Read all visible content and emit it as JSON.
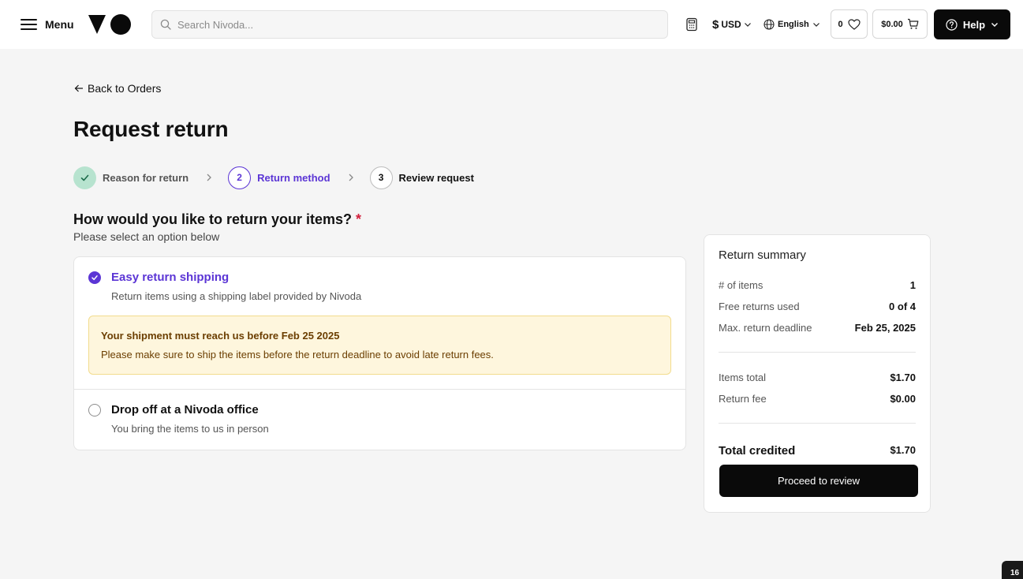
{
  "header": {
    "menu_label": "Menu",
    "search_placeholder": "Search Nivoda...",
    "currency_symbol": "$",
    "currency_label": "USD",
    "language_label": "English",
    "wishlist_count": "0",
    "cart_total": "$0.00",
    "help_label": "Help"
  },
  "nav": {
    "back_label": "Back to Orders"
  },
  "page": {
    "title": "Request return"
  },
  "steps": [
    {
      "number": "1",
      "label": "Reason for return",
      "state": "done"
    },
    {
      "number": "2",
      "label": "Return method",
      "state": "active"
    },
    {
      "number": "3",
      "label": "Review request",
      "state": "todo"
    }
  ],
  "question": {
    "title": "How would you like to return your items?",
    "required_mark": "*",
    "subtitle": "Please select an option below"
  },
  "options": [
    {
      "title": "Easy return shipping",
      "description": "Return items using a shipping label provided by Nivoda",
      "selected": true,
      "notice_title": "Your shipment must reach us before Feb 25 2025",
      "notice_text": "Please make sure to ship the items before the return deadline to avoid late return fees."
    },
    {
      "title": "Drop off at a Nivoda office",
      "description": "You bring the items to us in person",
      "selected": false
    }
  ],
  "summary": {
    "title": "Return summary",
    "rows": [
      {
        "label": "# of items",
        "value": "1"
      },
      {
        "label": "Free returns used",
        "value": "0 of 4"
      },
      {
        "label": "Max. return deadline",
        "value": "Feb 25, 2025"
      },
      {
        "label": "Items total",
        "value": "$1.70"
      },
      {
        "label": "Return fee",
        "value": "$0.00"
      }
    ],
    "total_label": "Total credited",
    "total_value": "$1.70",
    "button_label": "Proceed to review"
  },
  "corner_badge": "16",
  "colors": {
    "accent": "#5b35d5",
    "step_done": "#b7e3cf",
    "notice_bg": "#fef6dd",
    "notice_text": "#6b3e00",
    "required": "#d21f3c",
    "primary_button": "#0a0a0a"
  }
}
